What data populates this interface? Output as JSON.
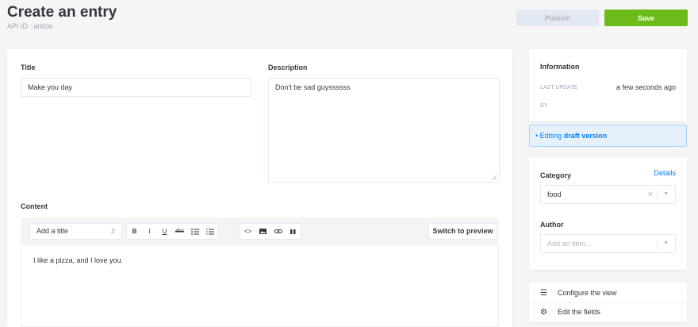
{
  "header": {
    "title": "Create an entry",
    "api_id": "API ID : article",
    "publish_label": "Publish",
    "save_label": "Save"
  },
  "fields": {
    "title": {
      "label": "Title",
      "value": "Make you day"
    },
    "description": {
      "label": "Description",
      "value": "Don't be sad guyssssss"
    },
    "content": {
      "label": "Content",
      "heading_select": "Add a title",
      "toolbar_icons": [
        "bold-icon",
        "italic-icon",
        "underline-icon",
        "strikethrough-icon",
        "bulleted-list-icon",
        "numbered-list-icon",
        "code-icon",
        "image-icon",
        "link-icon",
        "quote-icon"
      ],
      "toolbar_glyphs": {
        "bold": "B",
        "italic": "I",
        "underline": "U",
        "strike": "abc"
      },
      "preview_label": "Switch to preview",
      "value": "I like a pizza, and I love you."
    }
  },
  "information": {
    "title": "Information",
    "last_update_key": "Last update",
    "last_update_value": "a few seconds ago",
    "by_key": "By"
  },
  "draft_notice": {
    "prefix": "Editing",
    "emphasis": "draft version"
  },
  "relations": {
    "category": {
      "label": "Category",
      "link": "Details",
      "value": "food"
    },
    "author": {
      "label": "Author",
      "placeholder": "Add an item..."
    }
  },
  "actions": {
    "configure_view": "Configure the view",
    "edit_fields": "Edit the fields"
  },
  "colors": {
    "save": "#6dbb1a",
    "publish_disabled": "#e3e9f3",
    "link": "#007eff",
    "draft_bg": "#e6f0fb"
  }
}
